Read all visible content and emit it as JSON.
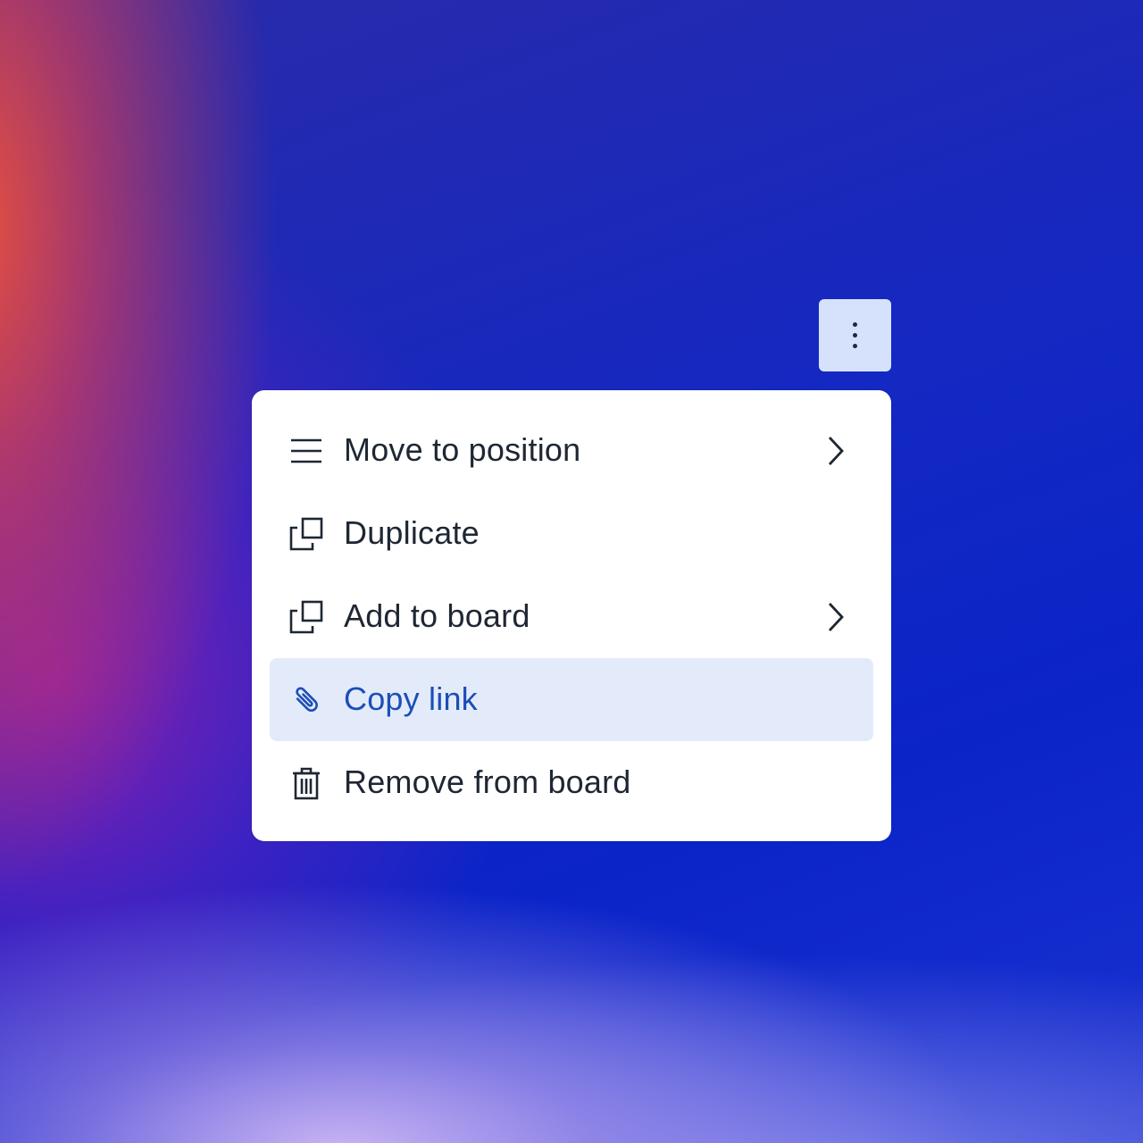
{
  "kebab_button": {
    "icon": "more-vertical-icon"
  },
  "menu": {
    "items": [
      {
        "label": "Move to position",
        "icon": "list-lines-icon",
        "has_submenu": true
      },
      {
        "label": "Duplicate",
        "icon": "duplicate-icon",
        "has_submenu": false
      },
      {
        "label": "Add to board",
        "icon": "add-to-board-icon",
        "has_submenu": true
      },
      {
        "label": "Copy link",
        "icon": "paperclip-icon",
        "has_submenu": false,
        "highlighted": true
      },
      {
        "label": "Remove from board",
        "icon": "trash-icon",
        "has_submenu": false
      }
    ]
  },
  "colors": {
    "menu_background": "#ffffff",
    "highlight_background": "#e3ebfb",
    "highlight_text": "#1c4eb6",
    "text": "#1e2733",
    "kebab_background": "#d6e2fb"
  }
}
